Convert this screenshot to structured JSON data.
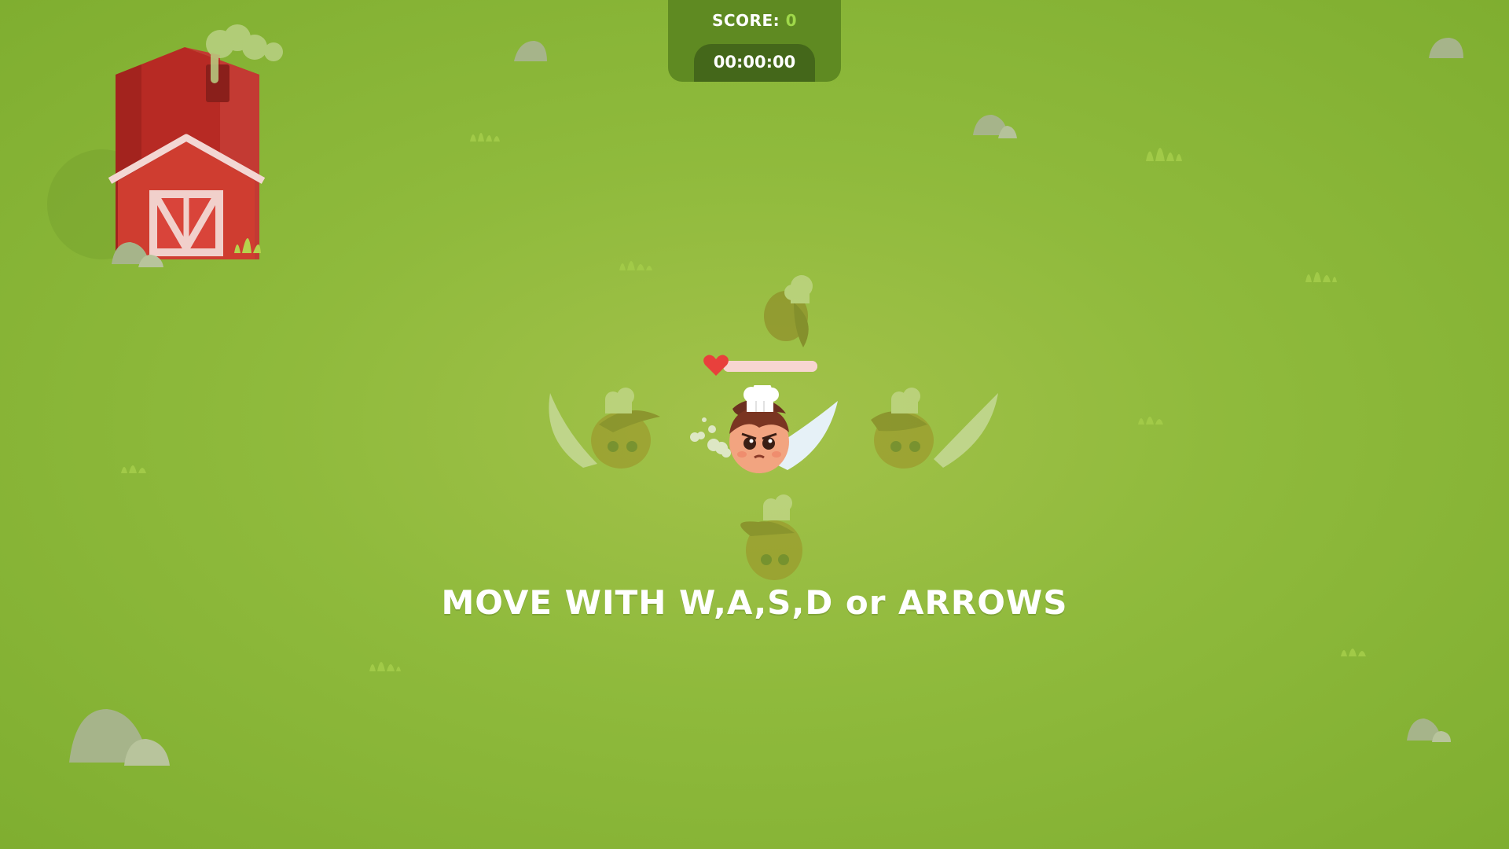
{
  "hud": {
    "score_label": "SCORE:",
    "score_value": "0",
    "timer": "00:00:00"
  },
  "hint": "MOVE WITH W,A,S,D or ARROWS",
  "player": {
    "health": 1.0
  },
  "colors": {
    "grass": "#8fba3c",
    "hud_panel": "#5f8a22",
    "timer_pill": "#44671a",
    "score_accent": "#9fd84a",
    "barn_red": "#c9302c",
    "heart": "#e8403c"
  },
  "icons": [
    "barn",
    "chimney-smoke",
    "rock",
    "grass-tuft",
    "heart-icon",
    "chef-player",
    "knife",
    "ghost-direction-hint"
  ]
}
